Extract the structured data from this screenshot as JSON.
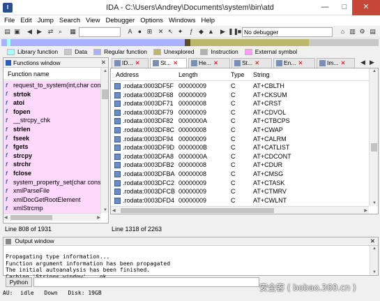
{
  "window": {
    "title": "IDA - C:\\Users\\Andrey\\Documents\\system\\bin\\atd",
    "minimize": "—",
    "maximize": "□",
    "close": "✕"
  },
  "menu": [
    "File",
    "Edit",
    "Jump",
    "Search",
    "View",
    "Debugger",
    "Options",
    "Windows",
    "Help"
  ],
  "toolbar": {
    "debugger_select": "No debugger"
  },
  "nav_colors": {
    "library": "#aaffff",
    "data": "#c8c8c8",
    "regular": "#aab2ff",
    "unexplored": "#bdb76b",
    "instruction": "#b2b2b2",
    "external": "#ff9cff"
  },
  "legend": [
    {
      "label": "Library function",
      "color": "#aaffff"
    },
    {
      "label": "Data",
      "color": "#c8c8c8"
    },
    {
      "label": "Regular function",
      "color": "#aab2ff"
    },
    {
      "label": "Unexplored",
      "color": "#bdb76b"
    },
    {
      "label": "Instruction",
      "color": "#b2b2b2"
    },
    {
      "label": "External symbol",
      "color": "#ff9cff"
    }
  ],
  "functions_window": {
    "title": "Functions window",
    "column": "Function name",
    "items": [
      {
        "name": "request_to_system(int,char const *,char *,int)",
        "bold": false
      },
      {
        "name": "strtok",
        "bold": true
      },
      {
        "name": "atoi",
        "bold": true
      },
      {
        "name": "fopen",
        "bold": true
      },
      {
        "name": "__strcpy_chk",
        "bold": false
      },
      {
        "name": "strlen",
        "bold": true
      },
      {
        "name": "fseek",
        "bold": true
      },
      {
        "name": "fgets",
        "bold": true
      },
      {
        "name": "strcpy",
        "bold": true
      },
      {
        "name": "strchr",
        "bold": true
      },
      {
        "name": "fclose",
        "bold": true
      },
      {
        "name": "system_property_set(char const *,char const *)",
        "bold": false
      },
      {
        "name": "xmlParseFile",
        "bold": false
      },
      {
        "name": "xmlDocGetRootElement",
        "bold": false
      },
      {
        "name": "xmlStrcmp",
        "bold": false
      }
    ],
    "status": "Line 808 of 1931"
  },
  "tabs": [
    {
      "label": "ID...",
      "active": false
    },
    {
      "label": "St...",
      "active": true
    },
    {
      "label": "He...",
      "active": false
    },
    {
      "label": "St...",
      "active": false
    },
    {
      "label": "En...",
      "active": false
    },
    {
      "label": "Im...",
      "active": false
    }
  ],
  "strings_window": {
    "columns": {
      "address": "Address",
      "length": "Length",
      "type": "Type",
      "string": "String"
    },
    "rows": [
      {
        "address": ".rodata:0003DF5F",
        "length": "00000009",
        "type": "C",
        "string": "AT+CBLTH"
      },
      {
        "address": ".rodata:0003DF68",
        "length": "00000009",
        "type": "C",
        "string": "AT+CKSUM"
      },
      {
        "address": ".rodata:0003DF71",
        "length": "00000008",
        "type": "C",
        "string": "AT+CRST"
      },
      {
        "address": ".rodata:0003DF79",
        "length": "00000009",
        "type": "C",
        "string": "AT+CDVOL"
      },
      {
        "address": ".rodata:0003DF82",
        "length": "0000000A",
        "type": "C",
        "string": "AT+CTBCPS"
      },
      {
        "address": ".rodata:0003DF8C",
        "length": "00000008",
        "type": "C",
        "string": "AT+CWAP"
      },
      {
        "address": ".rodata:0003DF94",
        "length": "00000009",
        "type": "C",
        "string": "AT+CALRM"
      },
      {
        "address": ".rodata:0003DF9D",
        "length": "0000000B",
        "type": "C",
        "string": "AT+CATLIST"
      },
      {
        "address": ".rodata:0003DFA8",
        "length": "0000000A",
        "type": "C",
        "string": "AT+CDCONT"
      },
      {
        "address": ".rodata:0003DFB2",
        "length": "00000008",
        "type": "C",
        "string": "AT+CDUR"
      },
      {
        "address": ".rodata:0003DFBA",
        "length": "00000008",
        "type": "C",
        "string": "AT+CMSG"
      },
      {
        "address": ".rodata:0003DFC2",
        "length": "00000009",
        "type": "C",
        "string": "AT+CTASK"
      },
      {
        "address": ".rodata:0003DFCB",
        "length": "00000009",
        "type": "C",
        "string": "AT+CTMRV"
      },
      {
        "address": ".rodata:0003DFD4",
        "length": "00000009",
        "type": "C",
        "string": "AT+CWLNT"
      }
    ],
    "status": "Line 1318 of 2263"
  },
  "output_window": {
    "title": "Output window",
    "lines": [
      "Propagating type information...",
      "Function argument information has been propagated",
      "The initial autoanalysis has been finished.",
      "Caching 'Strings window'... ok"
    ]
  },
  "python": {
    "button": "Python"
  },
  "statusbar": {
    "au": "AU:",
    "state": "idle",
    "dir": "Down",
    "disk": "Disk: 19GB"
  },
  "watermark": "安全客 ( bobao.360.cn )"
}
